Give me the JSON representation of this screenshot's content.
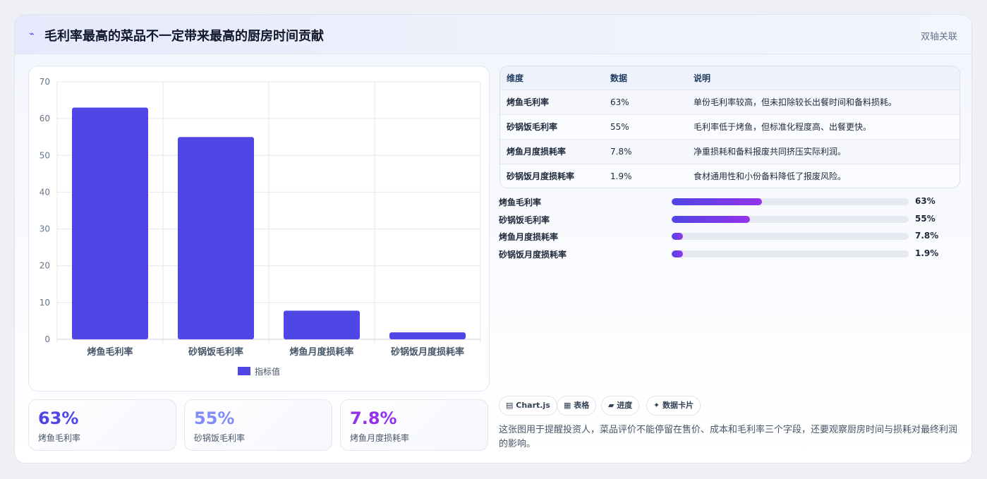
{
  "header": {
    "icon": "sparkline-icon",
    "title": "毛利率最高的菜品不一定带来最高的厨房时间贡献",
    "tag": "双轴关联"
  },
  "chart_data": {
    "type": "bar",
    "categories": [
      "烤鱼毛利率",
      "砂锅饭毛利率",
      "烤鱼月度损耗率",
      "砂锅饭月度损耗率"
    ],
    "series": [
      {
        "name": "指标值",
        "values": [
          63,
          55,
          7.8,
          1.9
        ],
        "color": "#4f46e5"
      }
    ],
    "ylim": [
      0,
      70
    ],
    "yticks": [
      0,
      10,
      20,
      30,
      40,
      50,
      60,
      70
    ],
    "grid": true,
    "legend": "bottom"
  },
  "stats": [
    {
      "value": "63%",
      "label": "烤鱼毛利率",
      "color": "#4f46e5"
    },
    {
      "value": "55%",
      "label": "砂锅饭毛利率",
      "color": "#818cf8"
    },
    {
      "value": "7.8%",
      "label": "烤鱼月度损耗率",
      "color": "#9333ea"
    }
  ],
  "table": {
    "headers": [
      "维度",
      "数据",
      "说明"
    ],
    "rows": [
      [
        "烤鱼毛利率",
        "63%",
        "单份毛利率较高，但未扣除较长出餐时间和备料损耗。"
      ],
      [
        "砂锅饭毛利率",
        "55%",
        "毛利率低于烤鱼，但标准化程度高、出餐更快。"
      ],
      [
        "烤鱼月度损耗率",
        "7.8%",
        "净重损耗和备料报废共同挤压实际利润。"
      ],
      [
        "砂锅饭月度损耗率",
        "1.9%",
        "食材通用性和小份备料降低了报废风险。"
      ]
    ]
  },
  "progress": [
    {
      "label": "烤鱼毛利率",
      "value": "63%",
      "fraction": 0.38
    },
    {
      "label": "砂锅饭毛利率",
      "value": "55%",
      "fraction": 0.33
    },
    {
      "label": "烤鱼月度损耗率",
      "value": "7.8%",
      "fraction": 0.047
    },
    {
      "label": "砂锅饭月度损耗率",
      "value": "1.9%",
      "fraction": 0.047
    }
  ],
  "chips": [
    {
      "icon": "chart-icon",
      "glyph": "▤",
      "label": "Chart.js"
    },
    {
      "icon": "table-icon",
      "glyph": "▦",
      "label": "表格"
    },
    {
      "icon": "progress-icon",
      "glyph": "▰",
      "label": "进度"
    },
    {
      "icon": "sparkle-icon",
      "glyph": "✦",
      "label": "数据卡片"
    }
  ],
  "note": "这张图用于提醒投资人，菜品评价不能停留在售价、成本和毛利率三个字段，还要观察厨房时间与损耗对最终利润的影响。"
}
